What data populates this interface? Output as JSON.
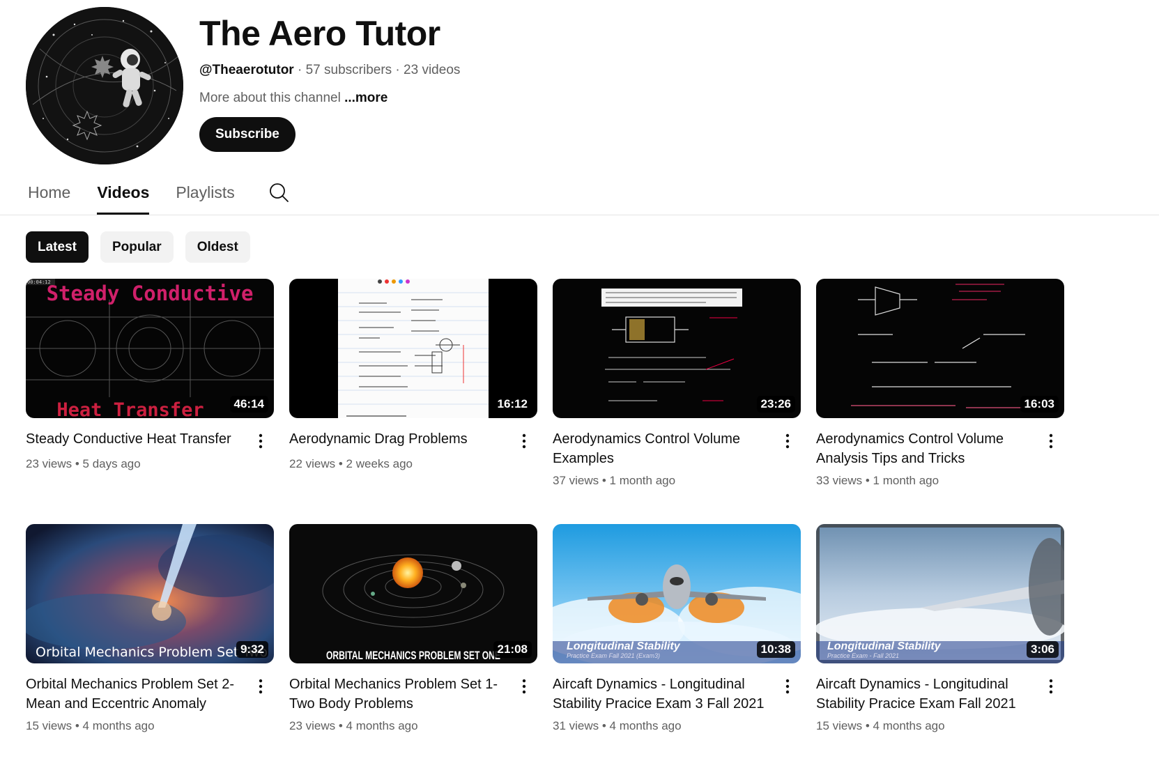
{
  "channel": {
    "name": "The Aero Tutor",
    "handle": "@Theaerotutor",
    "subscribers": "57 subscribers",
    "videos_count": "23 videos",
    "separator": " · ",
    "about": "More about this channel",
    "more": "...more",
    "subscribe_label": "Subscribe"
  },
  "tabs": [
    {
      "label": "Home"
    },
    {
      "label": "Videos",
      "active": true
    },
    {
      "label": "Playlists"
    }
  ],
  "chips": [
    {
      "label": "Latest",
      "active": true
    },
    {
      "label": "Popular"
    },
    {
      "label": "Oldest"
    }
  ],
  "videos": [
    {
      "title": "Steady Conductive Heat Transfer",
      "views": "23 views",
      "age": "5 days ago",
      "duration": "46:14",
      "thumb_text_top": "Steady Conductive",
      "thumb_text_bottom": "Heat Transfer",
      "thumb_timestamp": "00:04:12"
    },
    {
      "title": "Aerodynamic Drag Problems",
      "views": "22 views",
      "age": "2 weeks ago",
      "duration": "16:12"
    },
    {
      "title": "Aerodynamics Control Volume Examples",
      "views": "37 views",
      "age": "1 month ago",
      "duration": "23:26"
    },
    {
      "title": "Aerodynamics Control Volume Analysis Tips and Tricks",
      "views": "33 views",
      "age": "1 month ago",
      "duration": "16:03"
    },
    {
      "title": "Orbital Mechanics Problem Set 2- Mean and Eccentric Anomaly",
      "views": "15 views",
      "age": "4 months ago",
      "duration": "9:32",
      "thumb_text": "Orbital Mechanics Problem Set Two"
    },
    {
      "title": "Orbital Mechanics Problem Set 1- Two Body Problems",
      "views": "23 views",
      "age": "4 months ago",
      "duration": "21:08",
      "thumb_text": "ORBITAL MECHANICS PROBLEM SET ONE"
    },
    {
      "title": "Aircaft Dynamics - Longitudinal Stability Pracice Exam 3 Fall 2021",
      "views": "31 views",
      "age": "4 months ago",
      "duration": "10:38",
      "thumb_text": "Longitudinal Stability",
      "thumb_subtext": "Practice Exam Fall 2021 (Exam3)"
    },
    {
      "title": "Aircaft Dynamics - Longitudinal Stability Pracice Exam Fall 2021",
      "views": "15 views",
      "age": "4 months ago",
      "duration": "3:06",
      "thumb_text": "Longitudinal Stability",
      "thumb_subtext": "Practice Exam - Fall 2021"
    }
  ],
  "meta_separator": " • ",
  "icons": {
    "search": "search-icon",
    "kebab": "more-vert-icon"
  },
  "colors": {
    "subscribe_bg": "#0f0f0f",
    "chip_bg": "#f2f2f2",
    "secondary_text": "#606060"
  }
}
